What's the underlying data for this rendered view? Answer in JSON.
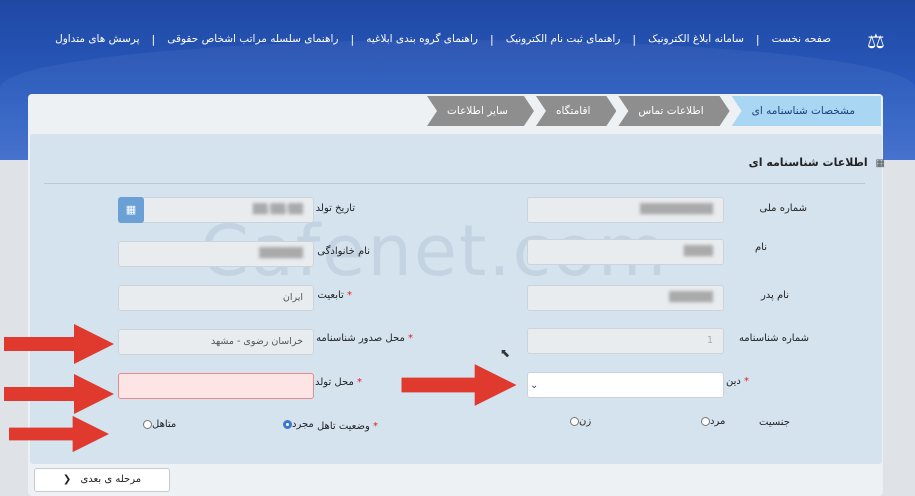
{
  "nav": {
    "items": [
      "صفحه نخست",
      "سامانه ابلاغ الکترونیک",
      "راهنمای ثبت نام الکترونیک",
      "راهنمای گروه بندی ابلاغیه",
      "راهنمای سلسله مراتب اشخاص حقوقی",
      "پرسش های متداول"
    ],
    "separator": "|"
  },
  "steps": [
    "مشخصات شناسنامه ای",
    "اطلاعات تماس",
    "اقامتگاه",
    "سایر اطلاعات"
  ],
  "section_title": "اطلاعات شناسنامه ای",
  "watermark": "Cafenet.com",
  "form": {
    "national_id_label": "شماره ملی",
    "name_label": "نام",
    "father_label": "نام پدر",
    "id_number_label": "شماره شناسنامه",
    "id_number_placeholder": "1",
    "religion_label": "دین",
    "gender_label": "جنسیت",
    "gender_male": "مرد",
    "gender_female": "زن",
    "birth_date_label": "تاریخ تولد",
    "family_label": "نام خانوادگی",
    "nationality_label": "تابعیت",
    "nationality_value": "ایران",
    "issue_place_label": "محل صدور شناسنامه",
    "issue_place_value": "خراسان رضوی - مشهد",
    "birth_place_label": "محل تولد",
    "marital_label": "وضعیت تاهل",
    "marital_single": "مجرد",
    "marital_married": "متاهل",
    "required_mark": "*"
  },
  "next_button": "مرحله ی بعدی",
  "colors": {
    "arrow": "#e03a2e",
    "accent": "#3b77d0"
  }
}
